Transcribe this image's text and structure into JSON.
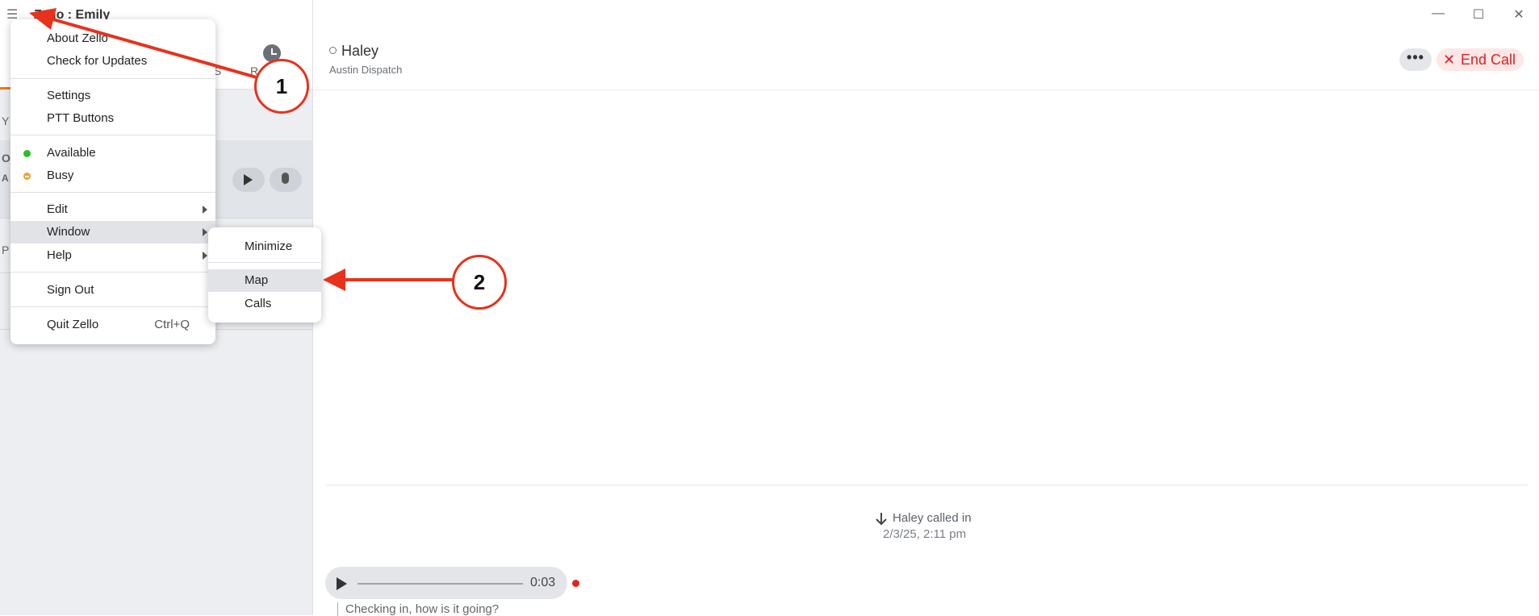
{
  "window": {
    "title": "Zello : Emily",
    "controls": {
      "minimize": "—",
      "maximize": "☐",
      "close": "✕"
    }
  },
  "sidebar": {
    "menu_icon": "☰",
    "recents_icon": "clock-icon",
    "fragments": [
      "S",
      "R",
      "Y",
      "O",
      "A",
      "P"
    ]
  },
  "main": {
    "contact_name": "Haley",
    "contact_sub": "Austin Dispatch",
    "more_label": "•••",
    "end_call_icon": "✕",
    "end_call_label": "End Call",
    "call_event": "Haley called in",
    "call_time": "2/3/25, 2:11 pm",
    "message_duration": "0:03",
    "transcript": "Checking in, how is it going?",
    "colors": {
      "end_call": "#e02020",
      "accent": "#f07b14",
      "available": "#2bbf2b",
      "busy": "#f2a12a"
    }
  },
  "menu": {
    "items": [
      {
        "label": "About Zello"
      },
      {
        "label": "Check for Updates"
      },
      {
        "label": "Settings"
      },
      {
        "label": "PTT Buttons"
      },
      {
        "label": "Available"
      },
      {
        "label": "Busy"
      },
      {
        "label": "Edit"
      },
      {
        "label": "Window"
      },
      {
        "label": "Help"
      },
      {
        "label": "Sign Out"
      },
      {
        "label": "Quit Zello",
        "shortcut": "Ctrl+Q"
      }
    ]
  },
  "submenu": {
    "items": [
      {
        "label": "Minimize"
      },
      {
        "label": "Map"
      },
      {
        "label": "Calls"
      }
    ]
  },
  "annotations": {
    "step1": "1",
    "step2": "2",
    "arrow_color": "#e8321c"
  }
}
